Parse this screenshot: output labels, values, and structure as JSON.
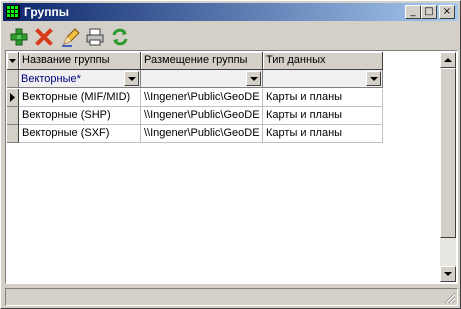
{
  "window": {
    "title": "Группы"
  },
  "title_buttons": {
    "minimize": "_",
    "maximize": "□",
    "close": "×"
  },
  "toolbar": {
    "buttons": [
      {
        "name": "add-button",
        "icon": "plus-icon"
      },
      {
        "name": "delete-button",
        "icon": "x-icon"
      },
      {
        "name": "edit-button",
        "icon": "pencil-icon"
      },
      {
        "name": "print-button",
        "icon": "printer-icon"
      },
      {
        "name": "refresh-button",
        "icon": "refresh-icon"
      }
    ]
  },
  "grid": {
    "columns": [
      "Название группы",
      "Размещение группы",
      "Тип данных"
    ],
    "filter": {
      "name": "Векторные*",
      "location": "",
      "type": ""
    },
    "rows": [
      {
        "name": "Векторные (MIF/MID)",
        "location": "\\\\Ingener\\Public\\GeoDE",
        "type": "Карты и планы"
      },
      {
        "name": "Векторные (SHP)",
        "location": "\\\\Ingener\\Public\\GeoDE",
        "type": "Карты и планы"
      },
      {
        "name": "Векторные (SXF)",
        "location": "\\\\Ingener\\Public\\GeoDE",
        "type": "Карты и планы"
      }
    ]
  },
  "colors": {
    "title_start": "#0a246a",
    "title_end": "#a6caf0",
    "filter_text": "#000080"
  }
}
